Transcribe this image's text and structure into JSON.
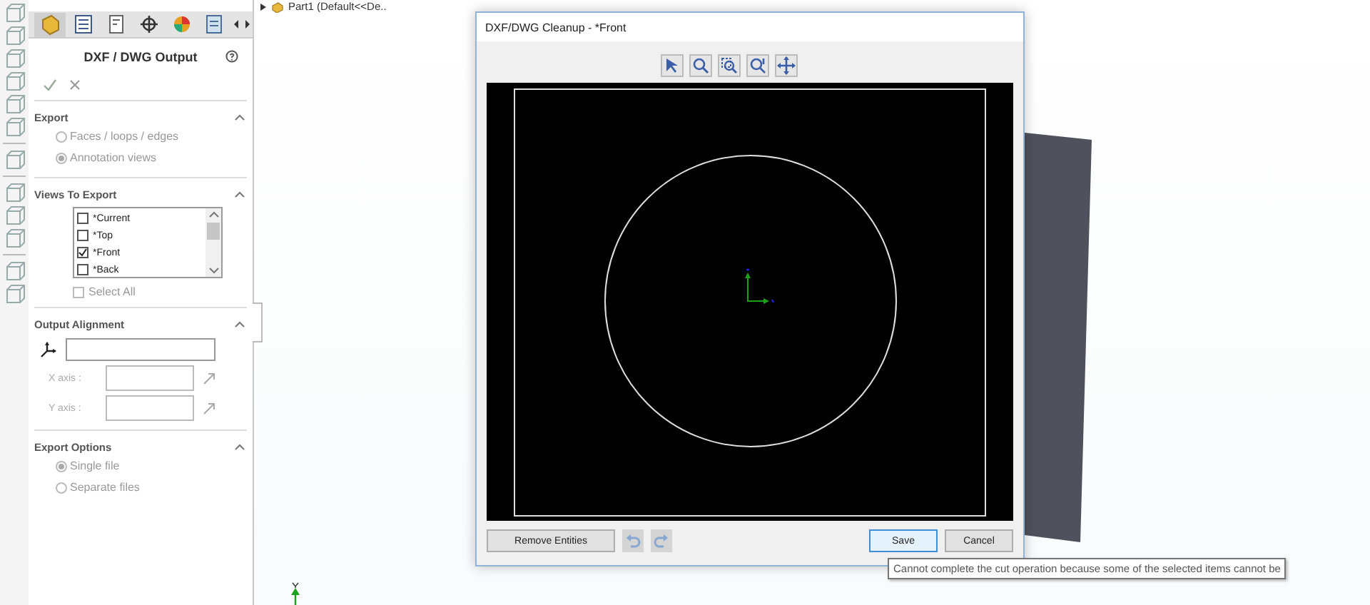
{
  "feature_tree": {
    "label": "Part1  (Default<<De.."
  },
  "property_manager": {
    "title": "DXF / DWG Output",
    "sections": [
      {
        "kind": "radios",
        "title": "Export",
        "expanded": true,
        "options": [
          {
            "label": "Faces / loops / edges",
            "selected": false,
            "disabled": true
          },
          {
            "label": "Annotation views",
            "selected": true,
            "disabled": true
          }
        ]
      },
      {
        "kind": "view_list",
        "title": "Views To Export",
        "expanded": true,
        "items": [
          {
            "label": "*Current",
            "checked": false
          },
          {
            "label": "*Top",
            "checked": false
          },
          {
            "label": "*Front",
            "checked": true
          },
          {
            "label": "*Back",
            "checked": false
          }
        ],
        "select_all": {
          "label": "Select All",
          "checked": false
        }
      },
      {
        "kind": "alignment",
        "title": "Output Alignment",
        "expanded": true,
        "axes": [
          {
            "label": "X axis :",
            "disabled": true
          },
          {
            "label": "Y axis :",
            "disabled": true
          }
        ]
      },
      {
        "kind": "radios",
        "title": "Export Options",
        "expanded": true,
        "options": [
          {
            "label": "Single file",
            "selected": true,
            "disabled": true
          },
          {
            "label": "Separate files",
            "selected": false,
            "disabled": true
          }
        ]
      }
    ]
  },
  "dialog": {
    "title": "DXF/DWG Cleanup - *Front",
    "buttons": [
      {
        "kind": "text",
        "label": "Remove Entities",
        "default": false
      },
      {
        "kind": "undo",
        "disabled": true
      },
      {
        "kind": "redo",
        "disabled": true
      },
      {
        "kind": "text",
        "label": "Save",
        "default": true
      },
      {
        "kind": "text",
        "label": "Cancel",
        "default": false
      }
    ]
  },
  "tooltip": {
    "text": "Cannot complete the cut operation because some of the selected items cannot be"
  }
}
